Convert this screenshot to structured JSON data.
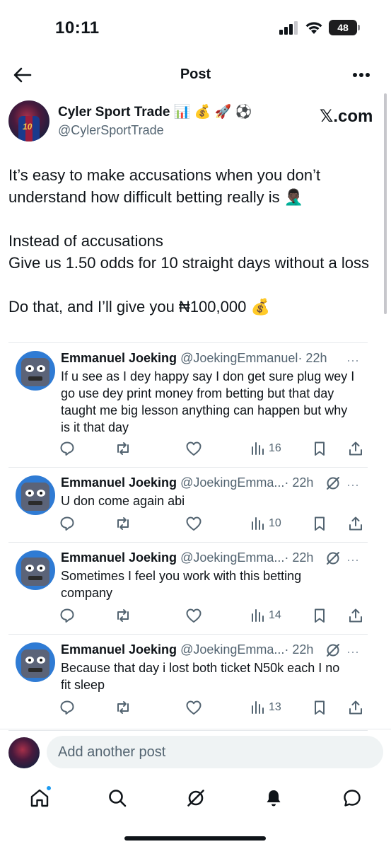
{
  "status_bar": {
    "time": "10:11",
    "battery": "48"
  },
  "header": {
    "title": "Post",
    "back_icon": "arrow-left-icon",
    "more_icon": "more-horizontal-icon"
  },
  "post": {
    "author_name": "Cyler Sport Trade 📊 💰 🚀 ⚽",
    "author_handle": "@CylerSportTrade",
    "source": "𝕏.com",
    "avatar_number": "10",
    "lines": [
      "It’s easy to make accusations when you don’t",
      "understand how difficult betting really is 🤦🏿‍♂️",
      "",
      "Instead of accusations",
      "Give  us 1.50 odds for 10 straight days without a loss",
      "",
      "Do that, and I’ll give you ₦100,000 💰"
    ]
  },
  "replies": [
    {
      "name": "Emmanuel Joeking",
      "handle": "@JoekingEmmanuel",
      "time": "· 22h",
      "more": "···",
      "lines": [
        "If u see as I dey happy say I don get sure plug wey I",
        "go use dey print money from betting but that day",
        "taught me big lesson anything can happen but why",
        "is it that day"
      ],
      "views": "16"
    },
    {
      "name": "Emmanuel Joeking",
      "handle": "@JoekingEmma...",
      "time": "· 22h",
      "more": "···",
      "lines": [
        "U don come again abi"
      ],
      "views": "10"
    },
    {
      "name": "Emmanuel Joeking",
      "handle": "@JoekingEmma...",
      "time": "· 22h",
      "more": "···",
      "lines": [
        "Sometimes I feel you work with this betting",
        "company"
      ],
      "views": "14"
    },
    {
      "name": "Emmanuel Joeking",
      "handle": "@JoekingEmma...",
      "time": "· 22h",
      "more": "···",
      "lines": [
        "Because that day i lost both ticket N50k each I no",
        "fit sleep"
      ],
      "views": "13"
    }
  ],
  "compose": {
    "placeholder": "Add another post"
  },
  "tabbar": [
    "home-icon",
    "search-icon",
    "grok-icon",
    "notifications-icon",
    "messages-icon"
  ],
  "colors": {
    "accent": "#1d9bf0",
    "secondary_text": "#536471",
    "divider": "#e6e9ec"
  }
}
